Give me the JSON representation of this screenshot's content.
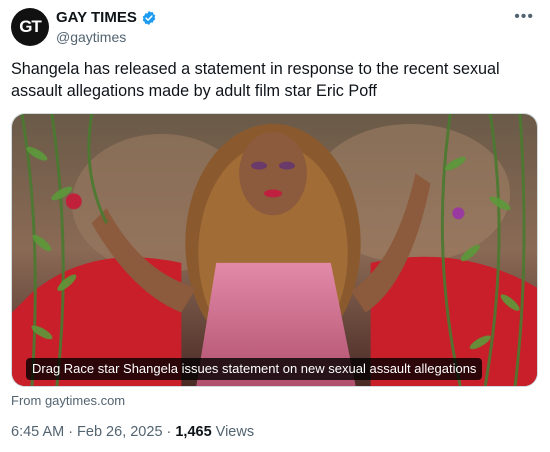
{
  "account": {
    "avatar_text": "GT",
    "display_name": "GAY TIMES",
    "handle": "@gaytimes",
    "verified_color": "#1d9bf0"
  },
  "tweet": {
    "text": "Shangela has released a statement in response to the recent sexual assault allegations made by adult film star Eric Poff"
  },
  "media": {
    "caption": "Drag Race star Shangela issues statement on new sexual assault allegations"
  },
  "card_source": "From gaytimes.com",
  "meta": {
    "time": "6:45 AM",
    "separator1": "·",
    "date": "Feb 26, 2025",
    "separator2": "·",
    "views_count": "1,465",
    "views_label": "Views"
  },
  "icons": {
    "more": "more-dots-icon",
    "verified": "verified-badge-icon"
  }
}
